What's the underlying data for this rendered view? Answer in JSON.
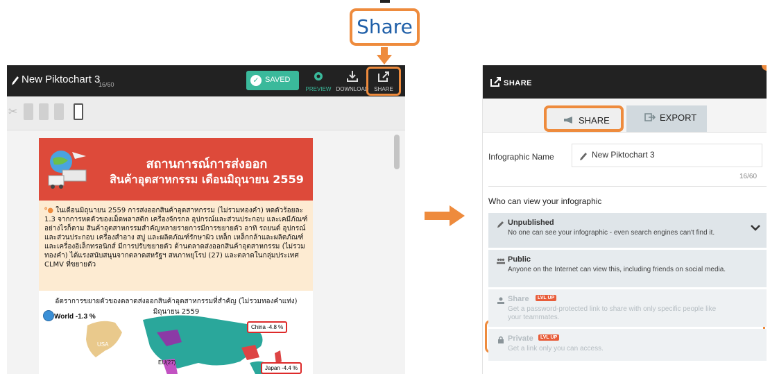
{
  "callout": {
    "label": "Share"
  },
  "editor": {
    "doc_title": "New Piktochart 3",
    "char_count": "16/60",
    "saved_label": "SAVED",
    "tools": {
      "preview": "PREVIEW",
      "download": "DOWNLOAD",
      "share": "SHARE"
    }
  },
  "infographic": {
    "title_line1": "สถานการณ์การส่งออก",
    "title_line2": "สินค้าอุตสาหกรรม เดือนมิถุนายน 2559",
    "body": "ในเดือนมิถุนายน 2559 การส่งออกสินค้าอุตสาหกรรม (ไม่รวมทองคำ) หดตัวร้อยละ 1.3 จากการหดตัวของเม็ดพลาสติก เครื่องจักรกล อุปกรณ์และส่วนประกอบ และเคมีภัณฑ์ อย่างไรก็ตาม สินค้าอุตสาหกรรมสำคัญหลายรายการมีการขยายตัว อาทิ รถยนต์ อุปกรณ์และส่วนประกอบ เครื่องสำอาง สบู่ และผลิตภัณฑ์รักษาผิว เหล็ก เหล็กกล้าและผลิตภัณฑ์ และเครื่องอิเล็กทรอนิกส์ มีการปรับขยายตัว ด้านตลาดส่งออกสินค้าอุตสาหกรรม (ไม่รวมทองคำ) ได้แรงสนับสนุนจากตลาดสหรัฐฯ สหภาพยุโรป (27) และตลาดในกลุ่มประเทศ CLMV ที่ขยายตัว",
    "chart_title": "อัตราการขยายตัวของตลาดส่งออกสินค้าอุตสาหกรรมที่สำคัญ (ไม่รวมทองคำแท่ง) มิถุนายน 2559",
    "world_label": "World -1.3 %",
    "usa_label": "USA",
    "eu_label": "EU(27)",
    "china_label": "China -4.8 %",
    "japan_label": "Japan -4.4 %"
  },
  "panel": {
    "header_title": "SHARE",
    "tab_share": "SHARE",
    "tab_export": "EXPORT",
    "name_label": "Infographic Name",
    "name_value": "New Piktochart 3",
    "name_count": "16/60",
    "who_label": "Who can view your infographic",
    "options": [
      {
        "title": "Unpublished",
        "desc": "No one can see your infographic - even search engines can't find it."
      },
      {
        "title": "Public",
        "desc": "Anyone on the Internet can view this, including friends on social media."
      },
      {
        "title": "Share",
        "badge": "LVL UP",
        "desc": "Get a password-protected link to share with only specific people like your teammates."
      },
      {
        "title": "Private",
        "badge": "LVL UP",
        "desc": "Get a link only you can access."
      }
    ]
  },
  "colors": {
    "highlight": "#ee8b3d",
    "saved": "#3ab99b",
    "header_red": "#dd4a3a",
    "dark_bar": "#222222"
  }
}
